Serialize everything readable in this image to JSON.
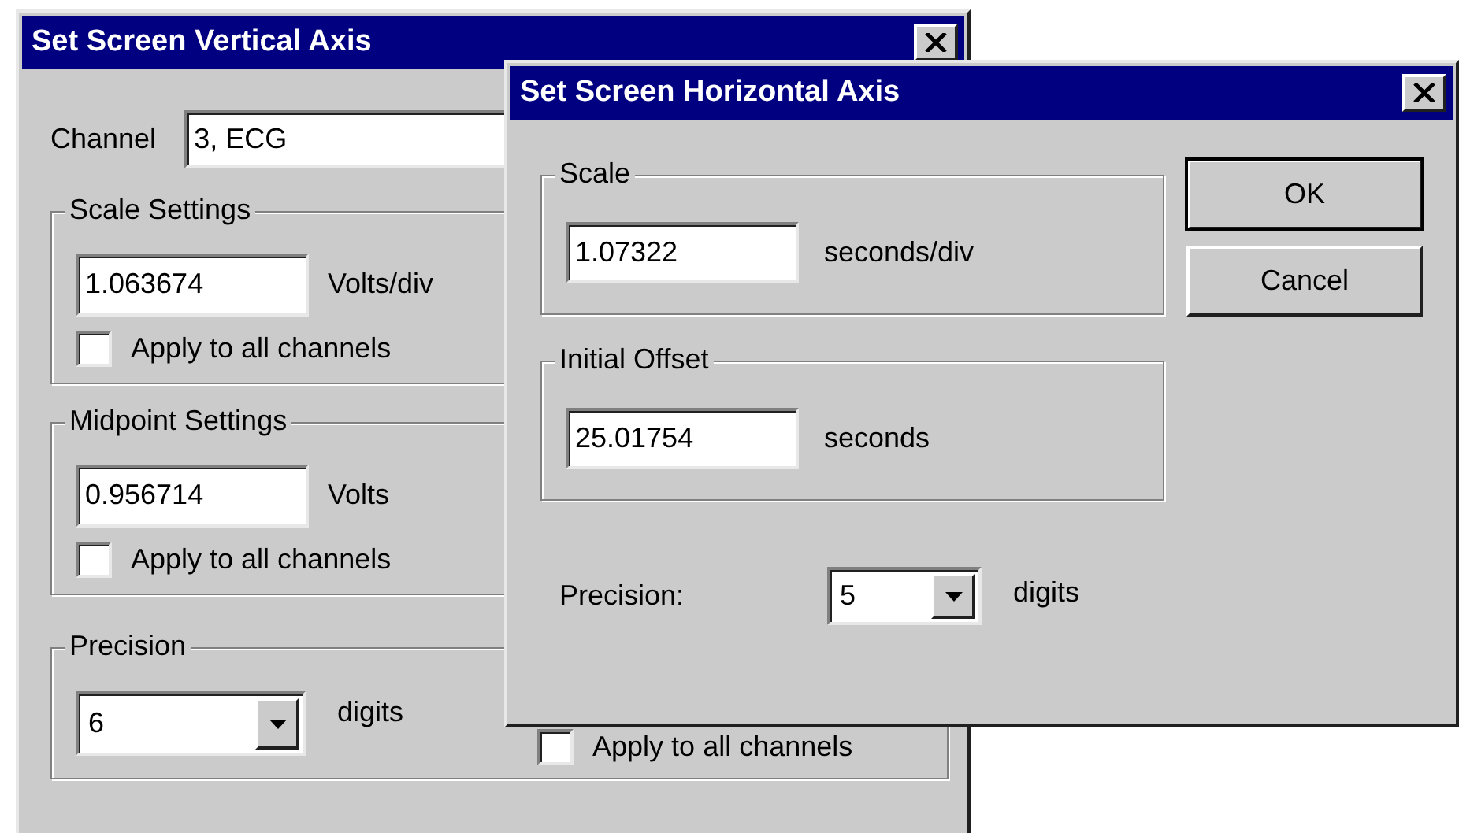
{
  "vertical_axis_dialog": {
    "title": "Set Screen Vertical Axis",
    "channel": {
      "label": "Channel",
      "value": "3, ECG"
    },
    "scale_settings": {
      "legend": "Scale Settings",
      "value": "1.063674",
      "unit": "Volts/div",
      "apply_all": {
        "label": "Apply to all channels",
        "checked": false
      }
    },
    "midpoint_settings": {
      "legend": "Midpoint Settings",
      "value": "0.956714",
      "unit": "Volts",
      "apply_all": {
        "label": "Apply to all channels",
        "checked": false
      }
    },
    "precision": {
      "legend": "Precision",
      "value": "6",
      "unit": "digits",
      "apply_all": {
        "label": "Apply to all channels",
        "checked": false
      }
    }
  },
  "horizontal_axis_dialog": {
    "title": "Set Screen Horizontal Axis",
    "scale": {
      "legend": "Scale",
      "value": "1.07322",
      "unit": "seconds/div"
    },
    "initial_offset": {
      "legend": "Initial Offset",
      "value": "25.01754",
      "unit": "seconds"
    },
    "precision": {
      "label": "Precision:",
      "value": "5",
      "unit": "digits"
    },
    "buttons": [
      {
        "label": "OK",
        "default": true
      },
      {
        "label": "Cancel",
        "default": false
      }
    ]
  }
}
